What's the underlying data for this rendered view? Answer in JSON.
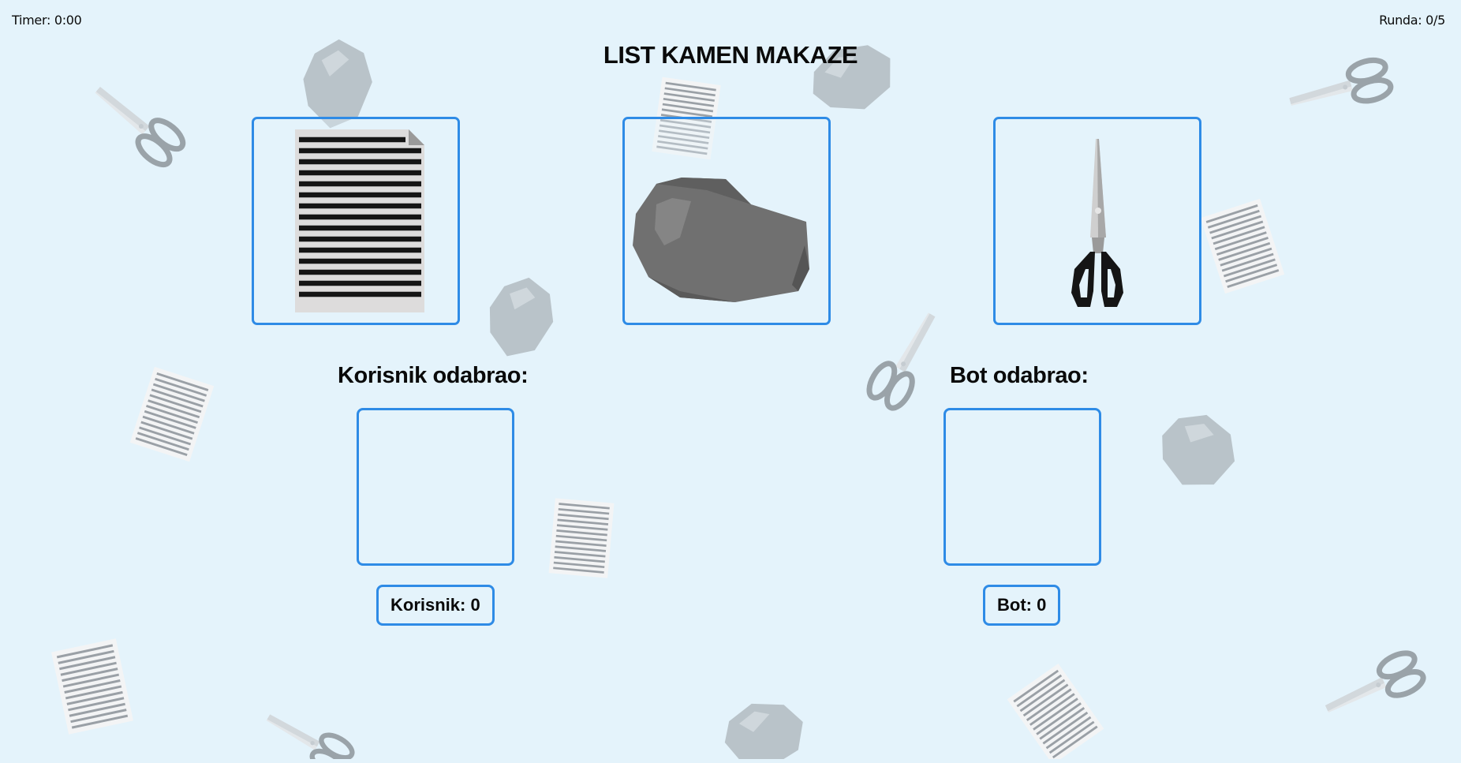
{
  "header": {
    "timer": "Timer: 0:00",
    "round": "Runda: 0/5",
    "title": "LIST KAMEN MAKAZE"
  },
  "choices": [
    {
      "id": "paper",
      "icon": "paper-icon"
    },
    {
      "id": "rock",
      "icon": "rock-icon"
    },
    {
      "id": "scissors",
      "icon": "scissors-icon"
    }
  ],
  "user": {
    "label": "Korisnik odabrao:",
    "score": "Korisnik: 0"
  },
  "bot": {
    "label": "Bot odabrao:",
    "score": "Bot: 0"
  },
  "colors": {
    "background": "#e4f3fb",
    "accent": "#2e8be6",
    "rock": "#707070",
    "decor": "#b9c3c9"
  }
}
